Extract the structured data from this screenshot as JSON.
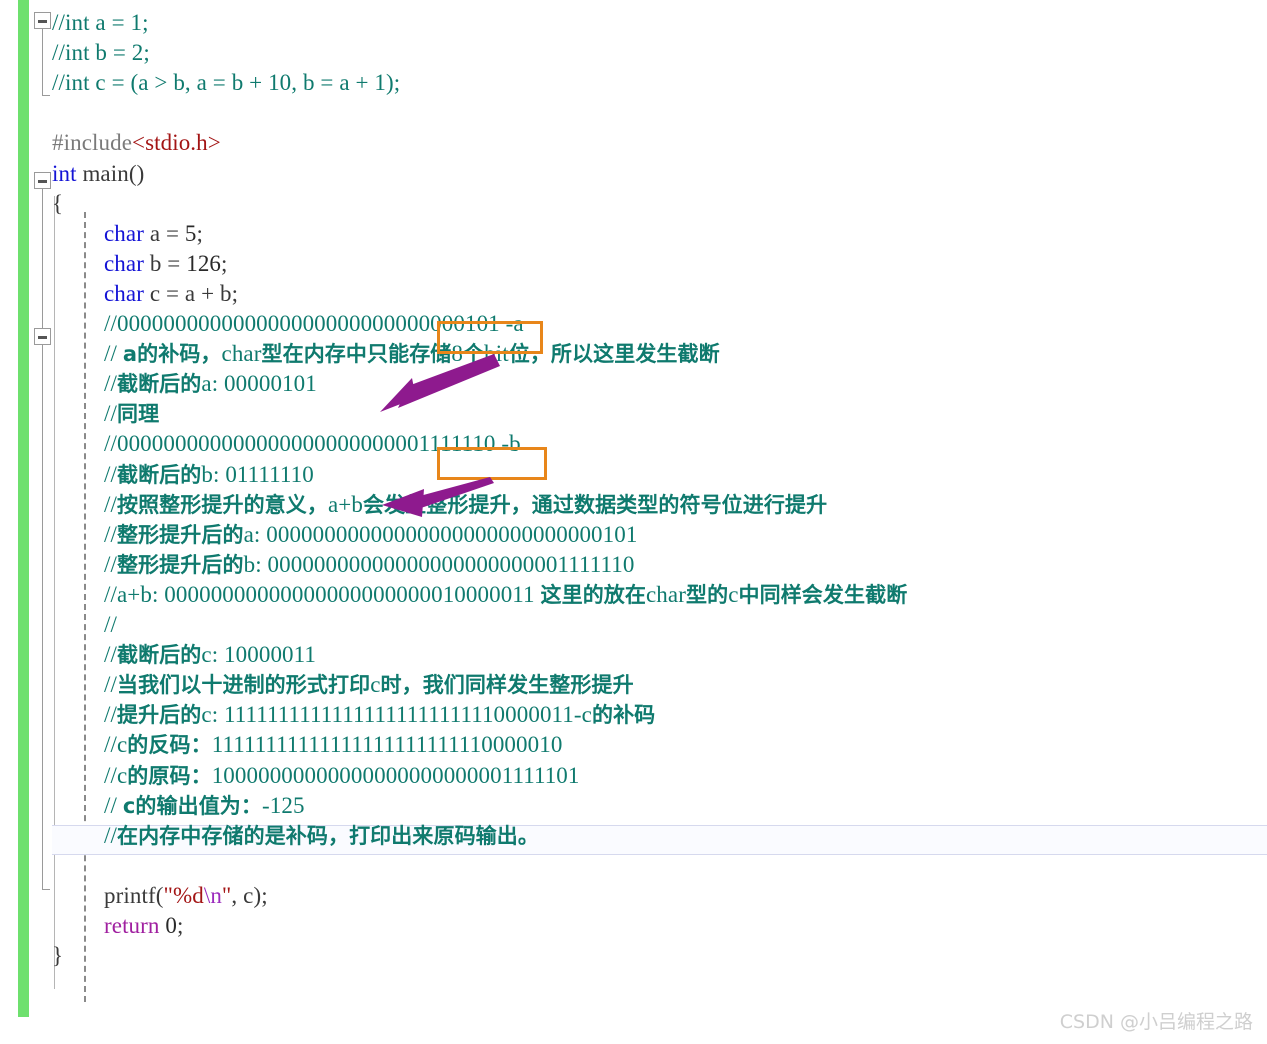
{
  "editor": {
    "language": "c",
    "watermark": "CSDN @小吕编程之路",
    "colors": {
      "comment": "#0f7a6e",
      "keyword": "#1414d6",
      "string": "#a31515",
      "escape": "#9b2bbd",
      "return_keyword": "#a020a0",
      "preprocessor": "#7a7a7a",
      "change_bar": "#6ee06e",
      "highlight_box": "#e8861a",
      "arrow": "#8e1a8e",
      "current_line_border": "#d6d9ee",
      "watermark": "#cfcfcf"
    }
  },
  "lines": [
    {
      "n": 1,
      "indent": 0,
      "tokens": [
        {
          "t": "cmt",
          "v": "//int a = 1;"
        }
      ]
    },
    {
      "n": 2,
      "indent": 0,
      "tokens": [
        {
          "t": "cmt",
          "v": "//int b = 2;"
        }
      ]
    },
    {
      "n": 3,
      "indent": 0,
      "tokens": [
        {
          "t": "cmt",
          "v": "//int c = (a > b, a = b + 10, b = a + 1);"
        }
      ]
    },
    {
      "n": 4,
      "indent": 0,
      "tokens": []
    },
    {
      "n": 5,
      "indent": 0,
      "tokens": [
        {
          "t": "pp",
          "v": "#include"
        },
        {
          "t": "inc",
          "v": "<stdio.h>"
        }
      ]
    },
    {
      "n": 6,
      "indent": 0,
      "tokens": [
        {
          "t": "kw",
          "v": "int"
        },
        {
          "t": "id",
          "v": " main"
        },
        {
          "t": "punct",
          "v": "()"
        }
      ]
    },
    {
      "n": 7,
      "indent": 0,
      "tokens": [
        {
          "t": "punct",
          "v": "{"
        }
      ]
    },
    {
      "n": 8,
      "indent": 1,
      "tokens": [
        {
          "t": "kw",
          "v": "char"
        },
        {
          "t": "id",
          "v": " a "
        },
        {
          "t": "punct",
          "v": "= "
        },
        {
          "t": "num",
          "v": "5"
        },
        {
          "t": "punct",
          "v": ";"
        }
      ]
    },
    {
      "n": 9,
      "indent": 1,
      "tokens": [
        {
          "t": "kw",
          "v": "char"
        },
        {
          "t": "id",
          "v": " b "
        },
        {
          "t": "punct",
          "v": "= "
        },
        {
          "t": "num",
          "v": "126"
        },
        {
          "t": "punct",
          "v": ";"
        }
      ]
    },
    {
      "n": 10,
      "indent": 1,
      "tokens": [
        {
          "t": "kw",
          "v": "char"
        },
        {
          "t": "id",
          "v": " c "
        },
        {
          "t": "punct",
          "v": "= "
        },
        {
          "t": "id",
          "v": "a "
        },
        {
          "t": "punct",
          "v": "+ "
        },
        {
          "t": "id",
          "v": "b"
        },
        {
          "t": "punct",
          "v": ";"
        }
      ]
    },
    {
      "n": 11,
      "indent": 1,
      "tokens": [
        {
          "t": "cmt",
          "v": "//0000000000000000000000000"
        },
        {
          "t": "cmt",
          "v": "00000101"
        },
        {
          "t": "cmt",
          "v": " -a"
        }
      ]
    },
    {
      "n": 12,
      "indent": 1,
      "tokens": [
        {
          "t": "cmt",
          "v": "// "
        },
        {
          "t": "cmt-cn",
          "v": "a的补码，"
        },
        {
          "t": "cmt",
          "v": "char"
        },
        {
          "t": "cmt-cn",
          "v": "型在内存中只能存储"
        },
        {
          "t": "cmt",
          "v": "8"
        },
        {
          "t": "cmt-cn",
          "v": "个"
        },
        {
          "t": "cmt",
          "v": "bit"
        },
        {
          "t": "cmt-cn",
          "v": "位，所以这里发生截断"
        }
      ]
    },
    {
      "n": 13,
      "indent": 1,
      "tokens": [
        {
          "t": "cmt",
          "v": "//"
        },
        {
          "t": "cmt-cn",
          "v": "截断后的"
        },
        {
          "t": "cmt",
          "v": "a: 00000101"
        }
      ]
    },
    {
      "n": 14,
      "indent": 1,
      "tokens": [
        {
          "t": "cmt",
          "v": "//"
        },
        {
          "t": "cmt-cn",
          "v": "同理"
        }
      ]
    },
    {
      "n": 15,
      "indent": 1,
      "tokens": [
        {
          "t": "cmt",
          "v": "//0000000000000000000000000"
        },
        {
          "t": "cmt",
          "v": "01111110"
        },
        {
          "t": "cmt",
          "v": " -b"
        }
      ]
    },
    {
      "n": 16,
      "indent": 1,
      "tokens": [
        {
          "t": "cmt",
          "v": "//"
        },
        {
          "t": "cmt-cn",
          "v": "截断后的"
        },
        {
          "t": "cmt",
          "v": "b: 01111110"
        }
      ]
    },
    {
      "n": 17,
      "indent": 1,
      "tokens": [
        {
          "t": "cmt",
          "v": "//"
        },
        {
          "t": "cmt-cn",
          "v": "按照整形提升的意义，"
        },
        {
          "t": "cmt",
          "v": "a+b"
        },
        {
          "t": "cmt-cn",
          "v": "会发生整形提升，通过数据类型的符号位进行提升"
        }
      ]
    },
    {
      "n": 18,
      "indent": 1,
      "tokens": [
        {
          "t": "cmt",
          "v": "//"
        },
        {
          "t": "cmt-cn",
          "v": "整形提升后的"
        },
        {
          "t": "cmt",
          "v": "a: 00000000000000000000000000000101"
        }
      ]
    },
    {
      "n": 19,
      "indent": 1,
      "tokens": [
        {
          "t": "cmt",
          "v": "//"
        },
        {
          "t": "cmt-cn",
          "v": "整形提升后的"
        },
        {
          "t": "cmt",
          "v": "b: 00000000000000000000000001111110"
        }
      ]
    },
    {
      "n": 20,
      "indent": 1,
      "tokens": [
        {
          "t": "cmt",
          "v": "//a+b: 00000000000000000000000010000011 "
        },
        {
          "t": "cmt-cn",
          "v": "这里的放在"
        },
        {
          "t": "cmt",
          "v": "char"
        },
        {
          "t": "cmt-cn",
          "v": "型的"
        },
        {
          "t": "cmt",
          "v": "c"
        },
        {
          "t": "cmt-cn",
          "v": "中同样会发生截断"
        }
      ]
    },
    {
      "n": 21,
      "indent": 1,
      "tokens": [
        {
          "t": "cmt",
          "v": "//"
        }
      ]
    },
    {
      "n": 22,
      "indent": 1,
      "tokens": [
        {
          "t": "cmt",
          "v": "//"
        },
        {
          "t": "cmt-cn",
          "v": "截断后的"
        },
        {
          "t": "cmt",
          "v": "c: 10000011"
        }
      ]
    },
    {
      "n": 23,
      "indent": 1,
      "tokens": [
        {
          "t": "cmt",
          "v": "//"
        },
        {
          "t": "cmt-cn",
          "v": "当我们以十进制的形式打印"
        },
        {
          "t": "cmt",
          "v": "c"
        },
        {
          "t": "cmt-cn",
          "v": "时，我们同样发生整形提升"
        }
      ]
    },
    {
      "n": 24,
      "indent": 1,
      "tokens": [
        {
          "t": "cmt",
          "v": "//"
        },
        {
          "t": "cmt-cn",
          "v": "提升后的"
        },
        {
          "t": "cmt",
          "v": "c: 11111111111111111111111110000011-c"
        },
        {
          "t": "cmt-cn",
          "v": "的补码"
        }
      ]
    },
    {
      "n": 25,
      "indent": 1,
      "tokens": [
        {
          "t": "cmt",
          "v": "//c"
        },
        {
          "t": "cmt-cn",
          "v": "的反码："
        },
        {
          "t": "cmt",
          "v": "11111111111111111111111110000010"
        }
      ]
    },
    {
      "n": 26,
      "indent": 1,
      "tokens": [
        {
          "t": "cmt",
          "v": "//c"
        },
        {
          "t": "cmt-cn",
          "v": "的原码："
        },
        {
          "t": "cmt",
          "v": "10000000000000000000000001111101"
        }
      ]
    },
    {
      "n": 27,
      "indent": 1,
      "tokens": [
        {
          "t": "cmt",
          "v": "// "
        },
        {
          "t": "cmt-cn",
          "v": "c的输出值为："
        },
        {
          "t": "cmt",
          "v": "-125"
        }
      ]
    },
    {
      "n": 28,
      "indent": 1,
      "tokens": [
        {
          "t": "cmt",
          "v": "//"
        },
        {
          "t": "cmt-cn",
          "v": "在内存中存储的是补码，打印出来原码输出。"
        }
      ]
    },
    {
      "n": 29,
      "indent": 1,
      "tokens": []
    },
    {
      "n": 30,
      "indent": 1,
      "tokens": [
        {
          "t": "id",
          "v": "printf"
        },
        {
          "t": "punct",
          "v": "("
        },
        {
          "t": "str",
          "v": "\"%d"
        },
        {
          "t": "esc",
          "v": "\\n"
        },
        {
          "t": "str",
          "v": "\""
        },
        {
          "t": "punct",
          "v": ", "
        },
        {
          "t": "id",
          "v": "c"
        },
        {
          "t": "punct",
          "v": ");"
        }
      ]
    },
    {
      "n": 31,
      "indent": 1,
      "tokens": [
        {
          "t": "ret",
          "v": "return"
        },
        {
          "t": "num",
          "v": " 0"
        },
        {
          "t": "punct",
          "v": ";"
        }
      ]
    },
    {
      "n": 32,
      "indent": 0,
      "tokens": [
        {
          "t": "punct",
          "v": "}"
        }
      ]
    }
  ],
  "annotations": {
    "highlight_boxes": [
      {
        "label": "a-truncated-bits-box",
        "bits": "00000101",
        "line": 11
      },
      {
        "label": "b-truncated-bits-box",
        "bits": "01111110",
        "line": 15
      }
    ],
    "arrows": [
      {
        "label": "arrow-a-truncation",
        "from_line": 11,
        "to_line": 13
      },
      {
        "label": "arrow-b-truncation",
        "from_line": 15,
        "to_line": 16
      }
    ]
  }
}
